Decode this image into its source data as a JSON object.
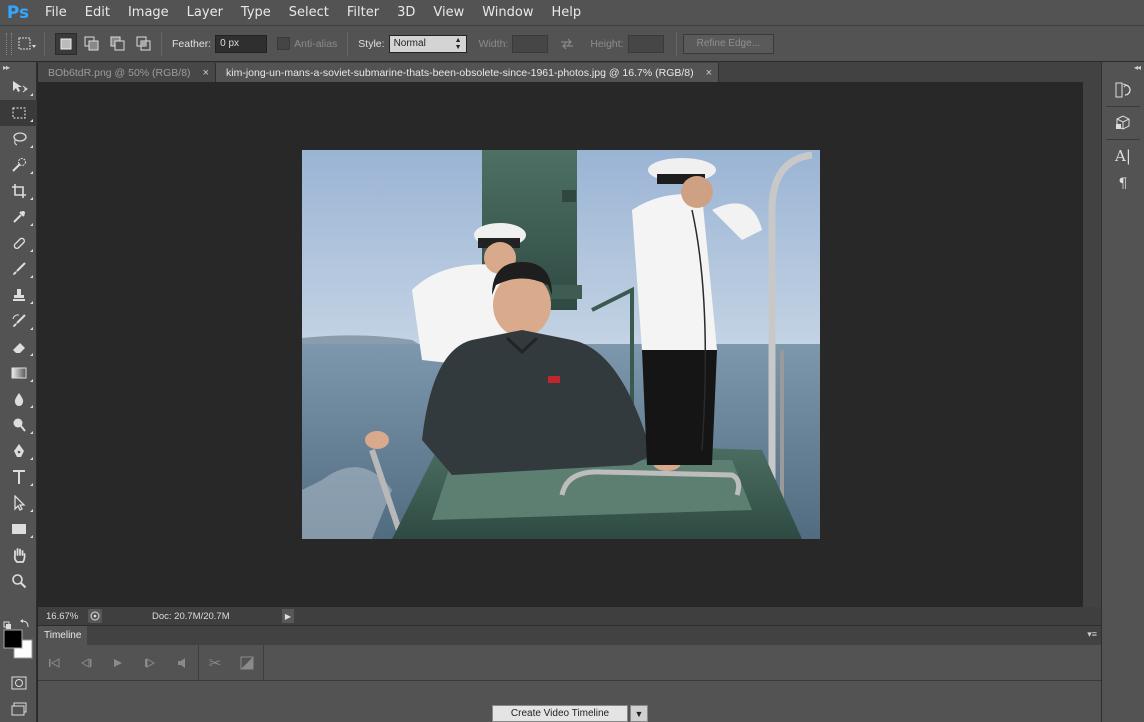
{
  "app": {
    "logo": "Ps"
  },
  "menu": [
    "File",
    "Edit",
    "Image",
    "Layer",
    "Type",
    "Select",
    "Filter",
    "3D",
    "View",
    "Window",
    "Help"
  ],
  "options": {
    "feather_label": "Feather:",
    "feather_value": "0 px",
    "antialias_label": "Anti-alias",
    "style_label": "Style:",
    "style_value": "Normal",
    "width_label": "Width:",
    "height_label": "Height:",
    "refine_label": "Refine Edge..."
  },
  "tabs": [
    {
      "title": "BOb6tdR.png @ 50% (RGB/8)",
      "active": false,
      "close": "×"
    },
    {
      "title": "kim-jong-un-mans-a-soviet-submarine-thats-been-obsolete-since-1961-photos.jpg @ 16.7% (RGB/8)",
      "active": true,
      "close": "×"
    }
  ],
  "status": {
    "zoom": "16.67%",
    "doc": "Doc: 20.7M/20.7M"
  },
  "timeline": {
    "tab_label": "Timeline",
    "create_label": "Create Video Timeline"
  }
}
